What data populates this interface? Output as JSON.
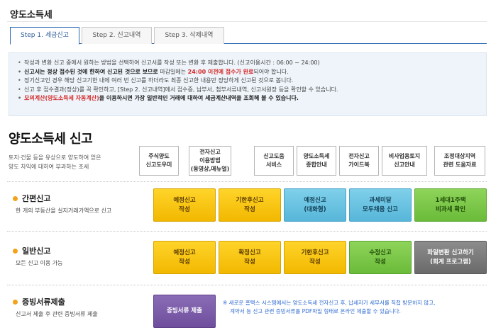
{
  "page": {
    "title": "양도소득세"
  },
  "tabs": [
    {
      "label": "Step 1. 세금신고"
    },
    {
      "label": "Step 2. 신고내역"
    },
    {
      "label": "Step 3. 삭제내역"
    }
  ],
  "notice": {
    "line1": "작성과 변환 신고 중에서 원하는 방법을 선택하여 신고서를 작성 또는 변환 후 제출합니다. (신고이용시간 : 06:00 ~ 24:00)",
    "line2_a": "신고서는 정상 접수된 것에 한하여 신고된 것으로 보므로",
    "line2_b": " 마감일에는 ",
    "line2_c": "24:00 이전에 접수가 완료",
    "line2_d": "되어야 합니다.",
    "line3": "정기신고인 경우 해당 신고기한 내에 여러 번 신고를 하더라도 최종 신고한 내용만 정당하게 신고된 것으로 봅니다.",
    "line4": "신고 후 접수결과(정상)를 꼭 확인하고, [Step 2. 신고내역]에서 접수증, 납부서, 첨부서류내역, 신고서원장 등을 확인할 수 있습니다.",
    "line5_a": "모의계산(양도소득세 자동계산)",
    "line5_b": "을 이용하시면 가장 일반적인 거래에 대하여 세금계산내역을 조회해 볼 수 있습니다."
  },
  "header": {
    "title": "양도소득세 신고",
    "desc1": "토지·건물 등을 유상으로 양도하여 얻은",
    "desc2": "양도 차익에 대하여 부과하는 조세"
  },
  "guides": [
    {
      "l1": "주식양도",
      "l2": "신고도우미",
      "l3": ""
    },
    {
      "l1": "전자신고",
      "l2": "이용방법",
      "l3": "(동영상,매뉴얼)"
    },
    {
      "l1": "신고도움",
      "l2": "서비스",
      "l3": ""
    },
    {
      "l1": "양도소득세",
      "l2": "종합안내",
      "l3": ""
    },
    {
      "l1": "전자신고",
      "l2": "가이드북",
      "l3": ""
    },
    {
      "l1": "비사업용토지",
      "l2": "신고안내",
      "l3": ""
    },
    {
      "l1": "조정대상지역",
      "l2": "관련 도움자료",
      "l3": ""
    }
  ],
  "simple": {
    "title": "간편신고",
    "desc": "한 개의 부동산을 실지거래가액으로 신고",
    "buttons": [
      {
        "l1": "예정신고",
        "l2": "작성"
      },
      {
        "l1": "기한후신고",
        "l2": "작성"
      },
      {
        "l1": "예정신고",
        "l2": "(대화형)"
      },
      {
        "l1": "과세미달",
        "l2": "모두채움 신고"
      },
      {
        "l1": "1세대1주택",
        "l2": "비과세 확인"
      }
    ]
  },
  "general": {
    "title": "일반신고",
    "desc": "모든 신고 이용 가능",
    "buttons": [
      {
        "l1": "예정신고",
        "l2": "작성"
      },
      {
        "l1": "확정신고",
        "l2": "작성"
      },
      {
        "l1": "기한후신고",
        "l2": "작성"
      },
      {
        "l1": "수정신고",
        "l2": "작성"
      },
      {
        "l1": "파일변환 신고하기",
        "l2": "(회계 프로그램)"
      }
    ]
  },
  "evidence": {
    "title": "증빙서류제출",
    "desc": "신고서 제출 후 관련 증빙서류 제출",
    "button": "증빙서류 제출",
    "note1": "※ 새로운 홈택스 시스템에서는 양도소득세 전자신고 후, 납세자가 세무서를 직접 방문하지 않고,",
    "note2": "계약서 등 신고 관련 증빙서류를 PDF파일 형태로 온라인 제출할 수 있습니다."
  },
  "colors": {
    "accent": "#2b6ab3",
    "bullet": "#f3a21b",
    "note": "#2f6bd0",
    "emphasis": "#d42a2a"
  }
}
